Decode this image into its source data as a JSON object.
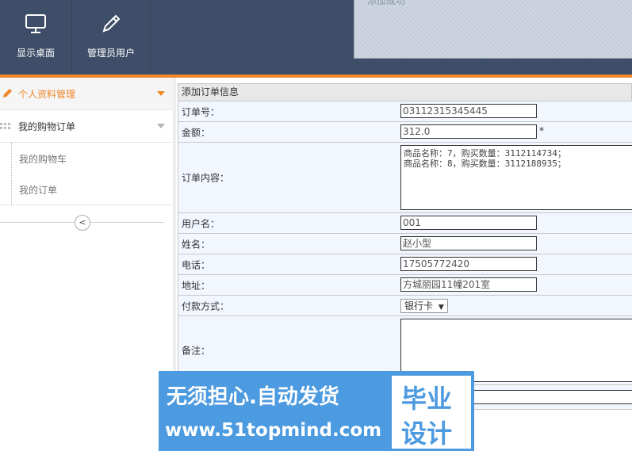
{
  "header": {
    "nav": [
      {
        "label": "显示桌面",
        "icon": "monitor-icon"
      },
      {
        "label": "管理员用户",
        "icon": "pencil-icon"
      }
    ],
    "notice_text": "添加成功"
  },
  "sidebar": {
    "menus": [
      {
        "label": "个人资料管理",
        "icon": "pencil-icon",
        "active": true
      },
      {
        "label": "我的购物订单",
        "icon": "grid-dots-icon",
        "active": false
      }
    ],
    "submenu": [
      "我的购物车",
      "我的订单"
    ],
    "collapse_glyph": "<"
  },
  "form": {
    "title": "添加订单信息",
    "fields": [
      {
        "label": "订单号：",
        "value": "03112315345445"
      },
      {
        "label": "金额：",
        "value": "312.0",
        "required_mark": "*"
      },
      {
        "label": "订单内容：",
        "value": "商品名称：7，购买数量：3112114734；\n商品名称：8，购买数量：3112188935；"
      },
      {
        "label": "用户名：",
        "value": "001"
      },
      {
        "label": "姓名：",
        "value": "赵小型"
      },
      {
        "label": "电话：",
        "value": "17505772420"
      },
      {
        "label": "地址：",
        "value": "方城丽园11幢201室"
      },
      {
        "label": "付款方式：",
        "value": "银行卡"
      },
      {
        "label": "备注：",
        "value": ""
      }
    ]
  },
  "watermark": {
    "line1": "无须担心.自动发货",
    "line2": "www.51topmind.com",
    "badge_top": "毕业",
    "badge_bottom": "设计"
  },
  "colors": {
    "header_bg": "#3e4e68",
    "accent": "#f0882a",
    "row_bg": "#f1f6ff",
    "watermark_bg": "#4c9ae0"
  }
}
